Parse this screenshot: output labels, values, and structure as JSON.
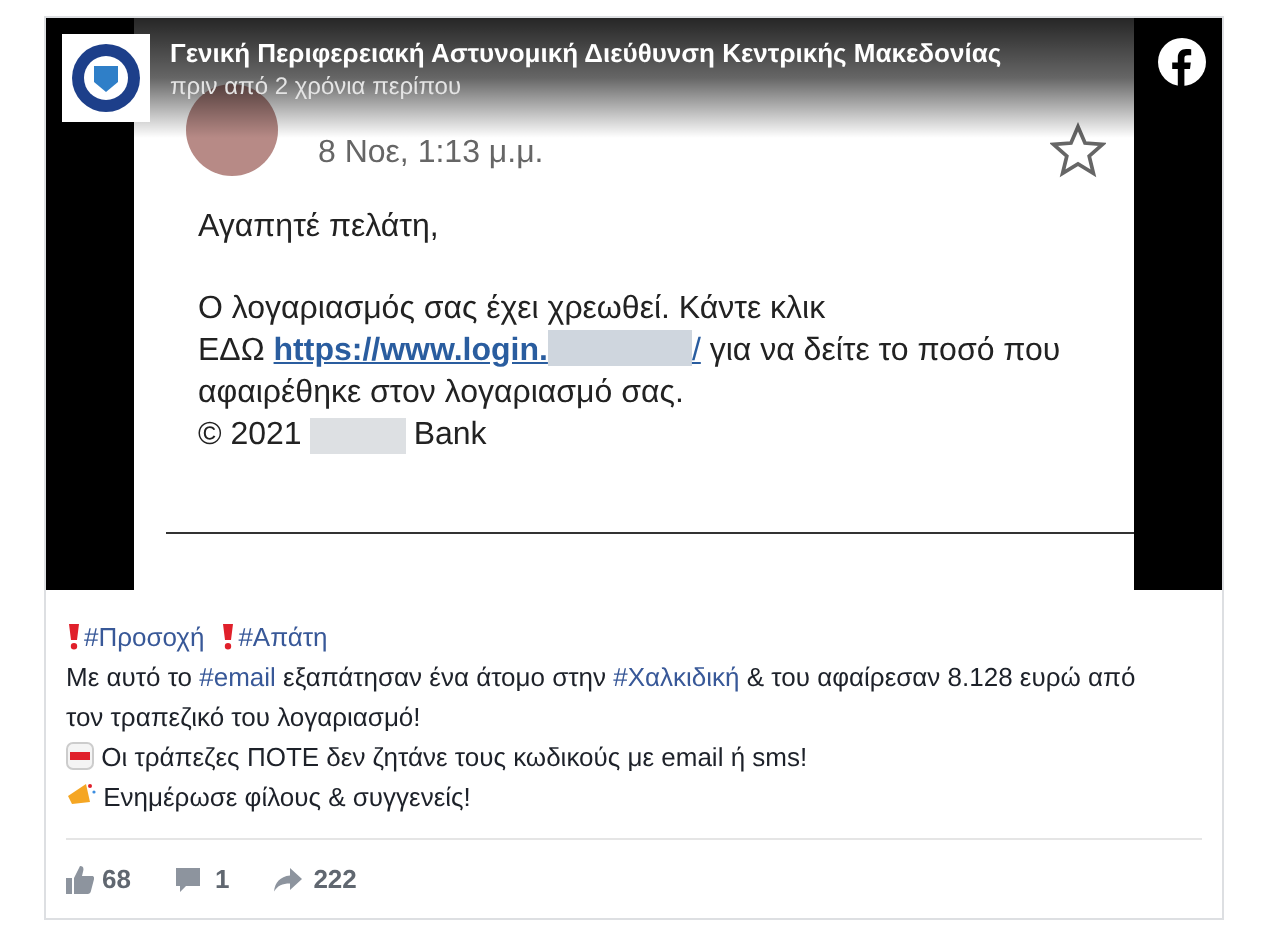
{
  "page": {
    "name": "Γενική Περιφερειακή Αστυνομική Διεύθυνση Κεντρικής Μακεδονίας",
    "time": "πριν από 2 χρόνια περίπου"
  },
  "media": {
    "date": "8 Νοε, 1:13 μ.μ.",
    "starred": false,
    "greeting": "Αγαπητέ πελάτη,",
    "line_1": "Ο λογαριασμός σας έχει χρεωθεί. Κάντε κλικ",
    "link_prefix": "ΕΔΩ",
    "link": "https://www.login.",
    "link_end": "/",
    "link_suffix": "για να δείτε το ποσό που αφαιρέθηκε στον λογαριασμό σας.",
    "copyright": "© 2021",
    "bank": "Bank"
  },
  "post": {
    "lines": [
      [
        {
          "kind": "alert"
        },
        {
          "kind": "hashtag",
          "text": "#Προσοχή"
        },
        {
          "kind": "alert"
        },
        {
          "kind": "hashtag",
          "text": "#Απάτη"
        }
      ],
      [
        {
          "kind": "text",
          "text": "Με αυτό το "
        },
        {
          "kind": "hashtag",
          "text": "#email"
        },
        {
          "kind": "text",
          "text": " εξαπάτησαν ένα άτομο στην "
        },
        {
          "kind": "hashtag",
          "text": "#Χαλκιδική"
        },
        {
          "kind": "text",
          "text": " & του αφαίρεσαν 8.128 ευρώ από τον τραπεζικό του λογαριασμό!"
        }
      ],
      [
        {
          "kind": "sos"
        },
        {
          "kind": "text",
          "text": " Οι τράπεζες ΠΟΤΕ δεν ζητάνε τους κωδικούς με email ή sms!"
        }
      ],
      [
        {
          "kind": "megaphone"
        },
        {
          "kind": "text",
          "text": " Ενημέρωσε φίλους & συγγενείς!"
        }
      ]
    ]
  },
  "stats": {
    "likes": "68",
    "comments": "1",
    "shares": "222"
  }
}
